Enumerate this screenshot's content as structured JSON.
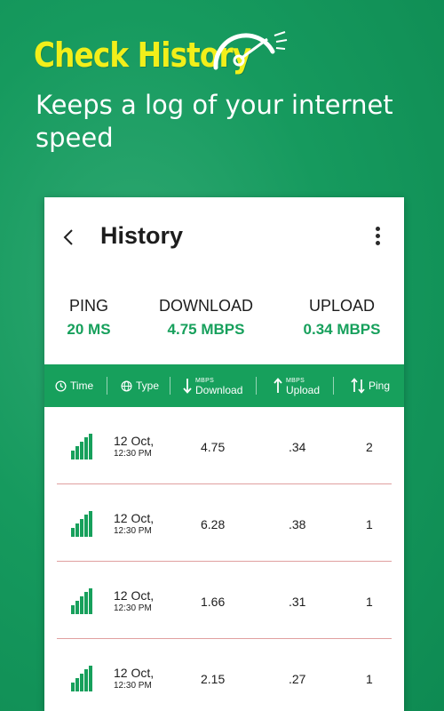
{
  "promo": {
    "title": "Check History",
    "subtitle": "Keeps a log of your internet speed"
  },
  "colors": {
    "accent": "#17a05c",
    "title_yellow": "#f2ef1a",
    "row_divider": "#e0a0a0"
  },
  "appbar": {
    "title": "History",
    "back_icon": "chevron-left-icon",
    "menu_icon": "more-vertical-icon"
  },
  "summary": {
    "ping_label": "PING",
    "ping_value": "20 MS",
    "download_label": "DOWNLOAD",
    "download_value": "4.75 MBPS",
    "upload_label": "UPLOAD",
    "upload_value": "0.34 MBPS"
  },
  "columns": {
    "time": "Time",
    "type": "Type",
    "download_unit": "MBPS",
    "download": "Download",
    "upload_unit": "MBPS",
    "upload": "Upload",
    "ping": "Ping"
  },
  "rows": [
    {
      "date": "12 Oct,",
      "time": "12:30 PM",
      "download": "4.75",
      "upload": ".34",
      "ping": "2"
    },
    {
      "date": "12 Oct,",
      "time": "12:30 PM",
      "download": "6.28",
      "upload": ".38",
      "ping": "1"
    },
    {
      "date": "12 Oct,",
      "time": "12:30 PM",
      "download": "1.66",
      "upload": ".31",
      "ping": "1"
    },
    {
      "date": "12 Oct,",
      "time": "12:30 PM",
      "download": "2.15",
      "upload": ".27",
      "ping": "1"
    }
  ]
}
